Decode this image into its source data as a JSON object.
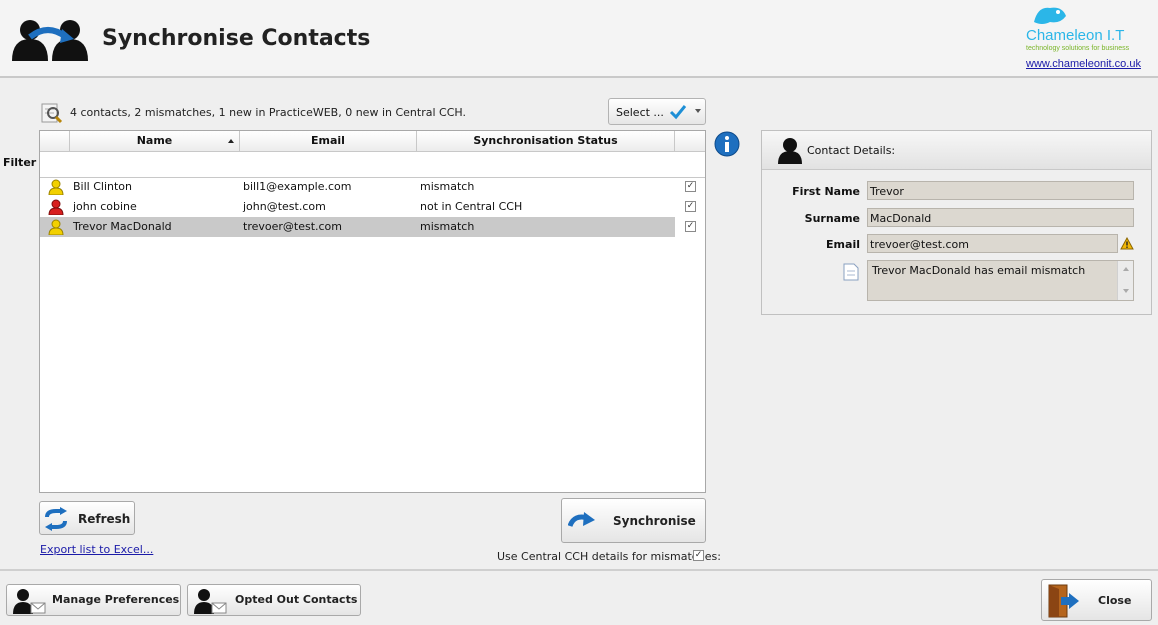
{
  "header": {
    "title": "Synchronise Contacts",
    "logo_name": "Chameleon I.T",
    "logo_tagline": "technology solutions for business",
    "logo_url": "www.chameleonit.co.uk"
  },
  "summary": "4 contacts, 2 mismatches, 1 new in PracticeWEB, 0 new in Central CCH.",
  "select_button": "Select ...",
  "filter_label": "Filter",
  "grid": {
    "columns": [
      "Name",
      "Email",
      "Synchronisation Status"
    ],
    "rows": [
      {
        "name": "Bill Clinton",
        "email": "bill1@example.com",
        "status": "mismatch",
        "icon": "user-yellow-icon",
        "checked": true
      },
      {
        "name": "john cobine",
        "email": "john@test.com",
        "status": "not in Central CCH",
        "icon": "user-red-icon",
        "checked": true
      },
      {
        "name": "Trevor MacDonald",
        "email": "trevoer@test.com",
        "status": "mismatch",
        "icon": "user-yellow-icon",
        "checked": true
      }
    ]
  },
  "buttons": {
    "refresh": "Refresh",
    "synchronise": "Synchronise",
    "export": "Export list to Excel...",
    "manage_preferences": "Manage Preferences",
    "opted_out": "Opted Out Contacts",
    "close": "Close"
  },
  "use_central_label": "Use Central CCH details for mismatches:",
  "details": {
    "title": "Contact Details:",
    "first_name_label": "First Name",
    "first_name": "Trevor",
    "surname_label": "Surname",
    "surname": "MacDonald",
    "email_label": "Email",
    "email": "trevoer@test.com",
    "note": "Trevor MacDonald has email mismatch"
  },
  "colors": {
    "accent_blue": "#1e6fbf",
    "selected_row": "#c9c9c9",
    "warning": "#f2b705"
  }
}
